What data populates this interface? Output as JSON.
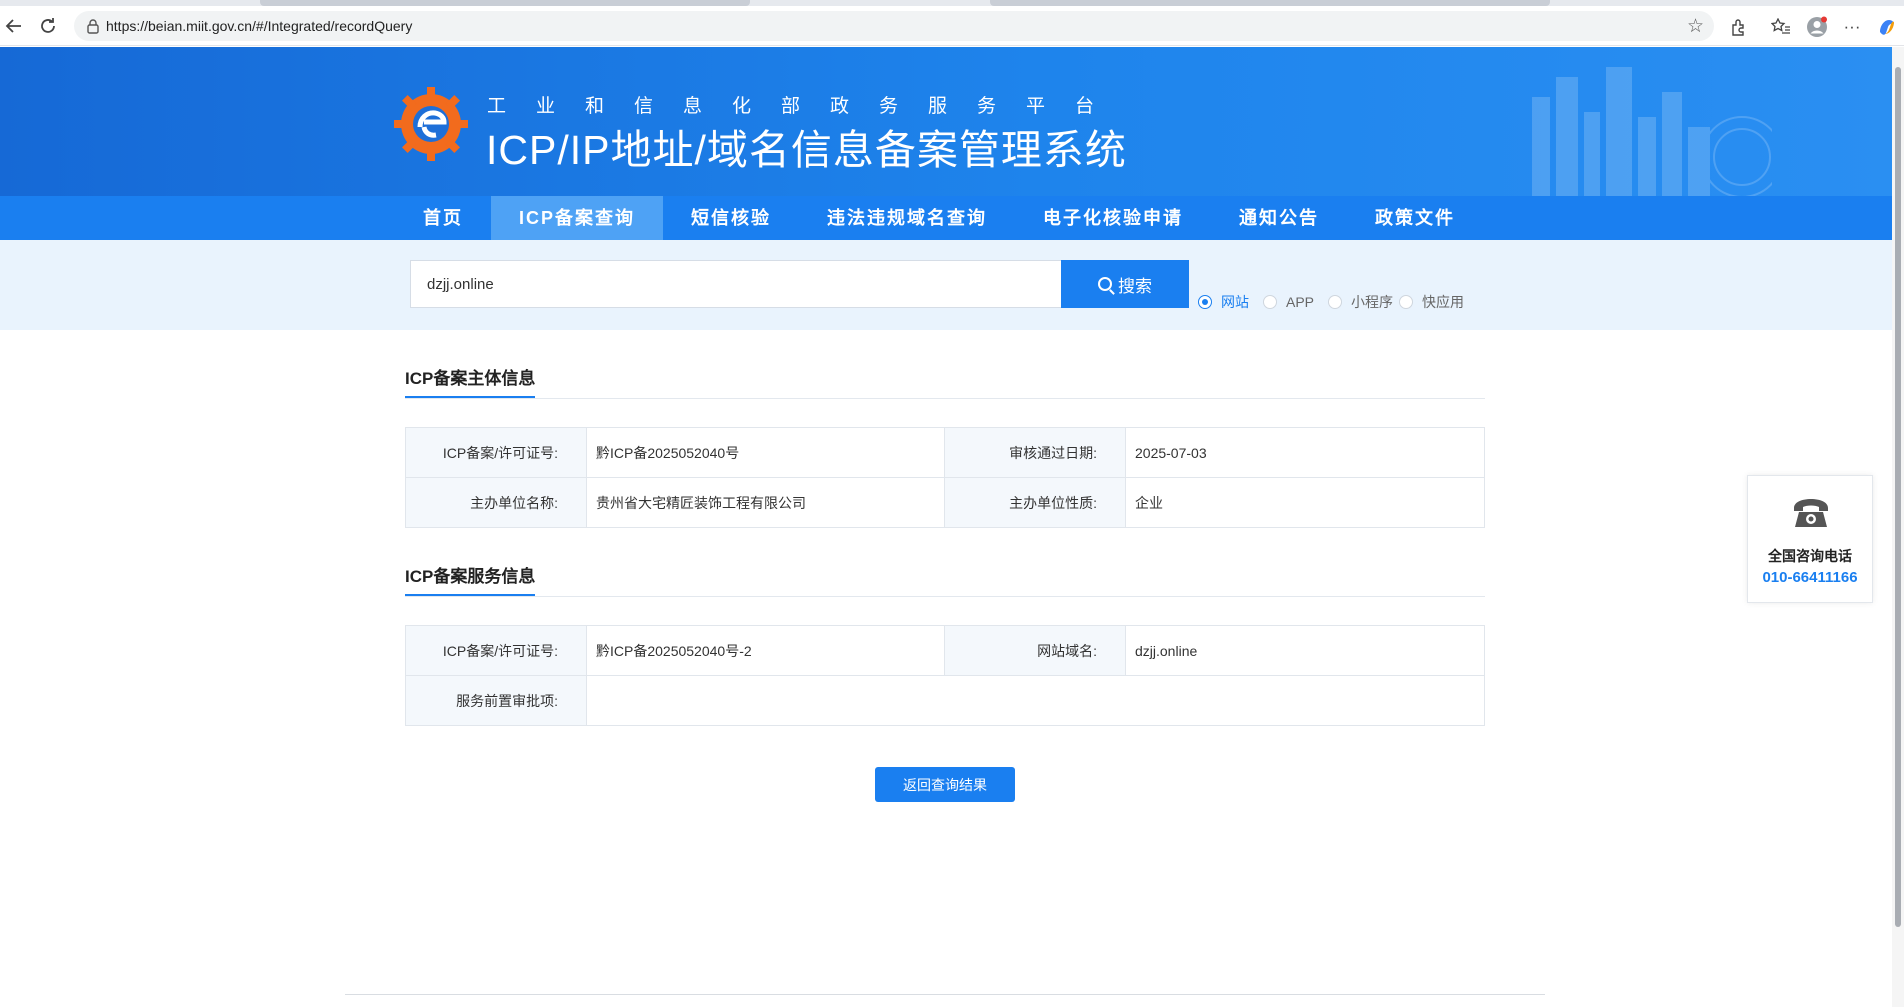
{
  "browser": {
    "url": "https://beian.miit.gov.cn/#/Integrated/recordQuery"
  },
  "header": {
    "org_name": "工业和信息化部政务服务平台",
    "system_name": "ICP/IP地址/域名信息备案管理系统"
  },
  "nav": {
    "items": [
      {
        "label": "首页"
      },
      {
        "label": "ICP备案查询"
      },
      {
        "label": "短信核验"
      },
      {
        "label": "违法违规域名查询"
      },
      {
        "label": "电子化核验申请"
      },
      {
        "label": "通知公告"
      },
      {
        "label": "政策文件"
      }
    ],
    "active_index": 1
  },
  "search": {
    "value": "dzjj.online",
    "button_label": "搜索",
    "types": [
      "网站",
      "APP",
      "小程序",
      "快应用"
    ],
    "selected_type": "网站"
  },
  "subject_info": {
    "title": "ICP备案主体信息",
    "license_label": "ICP备案/许可证号:",
    "license_value": "黔ICP备2025052040号",
    "approve_date_label": "审核通过日期:",
    "approve_date_value": "2025-07-03",
    "org_name_label": "主办单位名称:",
    "org_name_value": "贵州省大宅精匠装饰工程有限公司",
    "org_type_label": "主办单位性质:",
    "org_type_value": "企业"
  },
  "service_info": {
    "title": "ICP备案服务信息",
    "license_label": "ICP备案/许可证号:",
    "license_value": "黔ICP备2025052040号-2",
    "domain_label": "网站域名:",
    "domain_value": "dzjj.online",
    "preapproval_label": "服务前置审批项:",
    "preapproval_value": ""
  },
  "back_button_label": "返回查询结果",
  "hotline": {
    "title": "全国咨询电话",
    "number": "010-66411166"
  },
  "colors": {
    "primary": "#1a7ff0",
    "banner": "#1e84ec",
    "search_bg": "#e9f3fd"
  }
}
